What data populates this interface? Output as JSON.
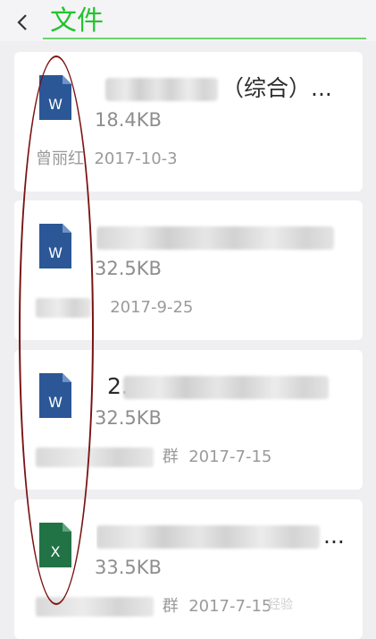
{
  "header": {
    "title": "文件",
    "back_icon": "chevron-left-icon"
  },
  "files": [
    {
      "type": "word",
      "icon_letter": "W",
      "icon_color": "#2b5797",
      "name_visible": "（综合）...",
      "size": "18.4KB",
      "sender": "曾丽红",
      "date": "2017-10-3"
    },
    {
      "type": "word",
      "icon_letter": "W",
      "icon_color": "#2b5797",
      "name_visible": "",
      "size": "32.5KB",
      "sender": "",
      "date": "2017-9-25"
    },
    {
      "type": "word",
      "icon_letter": "W",
      "icon_color": "#2b5797",
      "name_visible": "2...",
      "size": "32.5KB",
      "sender": "群",
      "date": "2017-7-15"
    },
    {
      "type": "excel",
      "icon_letter": "X",
      "icon_color": "#217346",
      "name_visible": "...",
      "size": "33.5KB",
      "sender": "群",
      "date": "2017-7-15"
    }
  ],
  "annotation": {
    "color": "#7a1313"
  },
  "watermark": "经验"
}
